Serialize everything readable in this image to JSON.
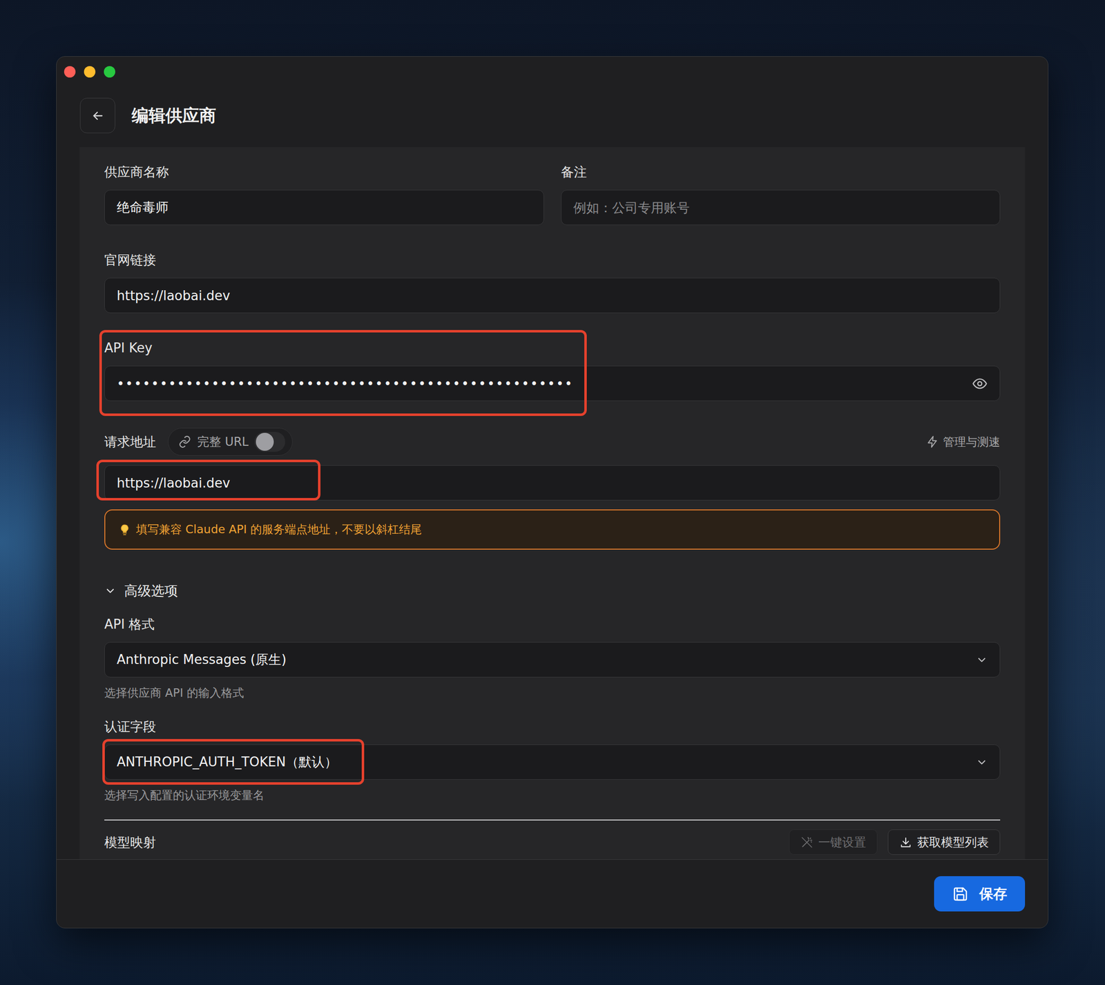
{
  "window": {
    "title": "编辑供应商"
  },
  "form": {
    "name": {
      "label": "供应商名称",
      "value": "绝命毒师",
      "highlighted": false
    },
    "note": {
      "label": "备注",
      "placeholder": "例如：公司专用账号",
      "highlighted": false
    },
    "website": {
      "label": "官网链接",
      "value": "https://laobai.dev",
      "highlighted": false
    },
    "api_key": {
      "label": "API Key",
      "value": "•••••••••••••••••••••••••••••••••••••••••••••••••••••",
      "highlighted": true
    },
    "request_url": {
      "label": "请求地址",
      "full_url_toggle": {
        "label": "完整 URL",
        "on": false
      },
      "manage_link": "管理与测速",
      "value": "https://laobai.dev",
      "highlighted": true,
      "hint": "填写兼容 Claude API 的服务端点地址，不要以斜杠结尾"
    },
    "advanced": {
      "label": "高级选项",
      "expanded": true
    },
    "api_format": {
      "label": "API 格式",
      "value": "Anthropic Messages (原生)",
      "helper": "选择供应商 API 的输入格式",
      "highlighted": false
    },
    "auth_field": {
      "label": "认证字段",
      "value": "ANTHROPIC_AUTH_TOKEN（默认）",
      "helper": "选择写入配置的认证环境变量名",
      "highlighted": true
    },
    "model_mapping": {
      "label": "模型映射",
      "buttons": [
        {
          "label": "一键设置",
          "disabled": true
        },
        {
          "label": "获取模型列表",
          "disabled": false
        }
      ]
    }
  },
  "buttons": [
    {
      "label": "保存"
    }
  ]
}
